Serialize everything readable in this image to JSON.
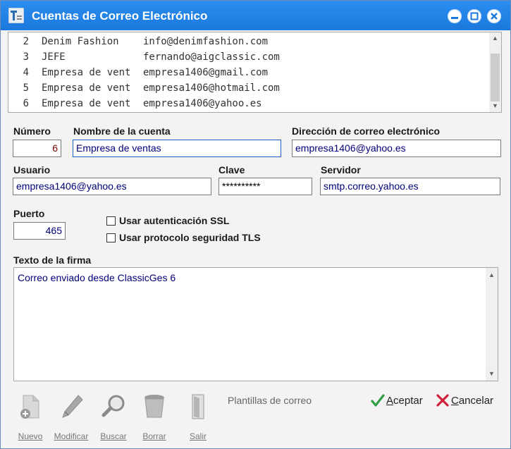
{
  "window": {
    "title": "Cuentas de Correo Electrónico"
  },
  "accounts": [
    {
      "num": "2",
      "name": "Denim Fashion",
      "email": "info@denimfashion.com"
    },
    {
      "num": "3",
      "name": "JEFE",
      "email": "fernando@aigclassic.com"
    },
    {
      "num": "4",
      "name": "Empresa de vent",
      "email": "empresa1406@gmail.com"
    },
    {
      "num": "5",
      "name": "Empresa de vent",
      "email": "empresa1406@hotmail.com"
    },
    {
      "num": "6",
      "name": "Empresa de vent",
      "email": "empresa1406@yahoo.es"
    }
  ],
  "form": {
    "numero_label": "Número",
    "numero": "6",
    "nombre_label": "Nombre de la cuenta",
    "nombre": "Empresa de ventas",
    "direccion_label": "Dirección de correo electrónico",
    "direccion": "empresa1406@yahoo.es",
    "usuario_label": "Usuario",
    "usuario": "empresa1406@yahoo.es",
    "clave_label": "Clave",
    "clave": "**********",
    "servidor_label": "Servidor",
    "servidor": "smtp.correo.yahoo.es",
    "puerto_label": "Puerto",
    "puerto": "465",
    "ssl_label": "Usar autenticación SSL",
    "ssl_checked": false,
    "tls_label": "Usar protocolo seguridad TLS",
    "tls_checked": false,
    "firma_label": "Texto de la firma",
    "firma": "Correo enviado desde ClassicGes 6"
  },
  "toolbar": {
    "nuevo": "Nuevo",
    "modificar": "Modificar",
    "buscar": "Buscar",
    "borrar": "Borrar",
    "salir": "Salir",
    "plantillas": "Plantillas de correo"
  },
  "actions": {
    "aceptar": "Aceptar",
    "cancelar": "Cancelar"
  },
  "colors": {
    "titlebar": "#1f82e6",
    "field_text": "#00007a",
    "accept_icon": "#2ea043",
    "cancel_icon": "#d0203a"
  }
}
